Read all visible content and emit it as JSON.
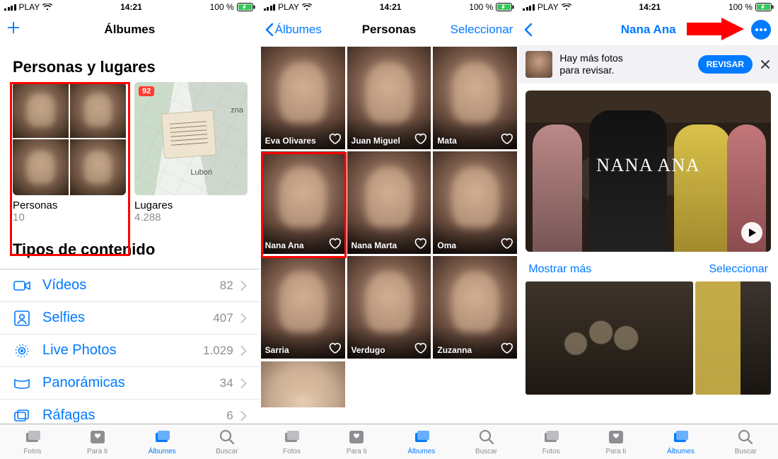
{
  "status": {
    "carrier": "PLAY",
    "time": "14:21",
    "battery": "100 %"
  },
  "tabbar": {
    "fotos": "Fotos",
    "parati": "Para ti",
    "albumes": "Álbumes",
    "buscar": "Buscar"
  },
  "screen1": {
    "nav_title": "Álbumes",
    "section1": "Personas y lugares",
    "personas_title": "Personas",
    "personas_count": "10",
    "lugares_title": "Lugares",
    "lugares_count": "4.288",
    "map_badge": "92",
    "map_place1": "zna",
    "map_place2": "Luboń",
    "section2": "Tipos de contenido",
    "rows": [
      {
        "label": "Vídeos",
        "count": "82"
      },
      {
        "label": "Selfies",
        "count": "407"
      },
      {
        "label": "Live Photos",
        "count": "1.029"
      },
      {
        "label": "Panorámicas",
        "count": "34"
      },
      {
        "label": "Ráfagas",
        "count": "6"
      }
    ]
  },
  "screen2": {
    "back": "Álbumes",
    "nav_title": "Personas",
    "select": "Seleccionar",
    "people": [
      "Eva Olivares",
      "Juan Miguel",
      "Mata",
      "Nana Ana",
      "Nana Marta",
      "Oma",
      "Sarria",
      "Verdugo",
      "Zuzanna"
    ]
  },
  "screen3": {
    "nav_title": "Nana Ana",
    "banner_text1": "Hay más fotos",
    "banner_text2": "para revisar.",
    "banner_btn": "REVISAR",
    "hero_title": "NANA ANA",
    "more": "Mostrar más",
    "select": "Seleccionar"
  }
}
